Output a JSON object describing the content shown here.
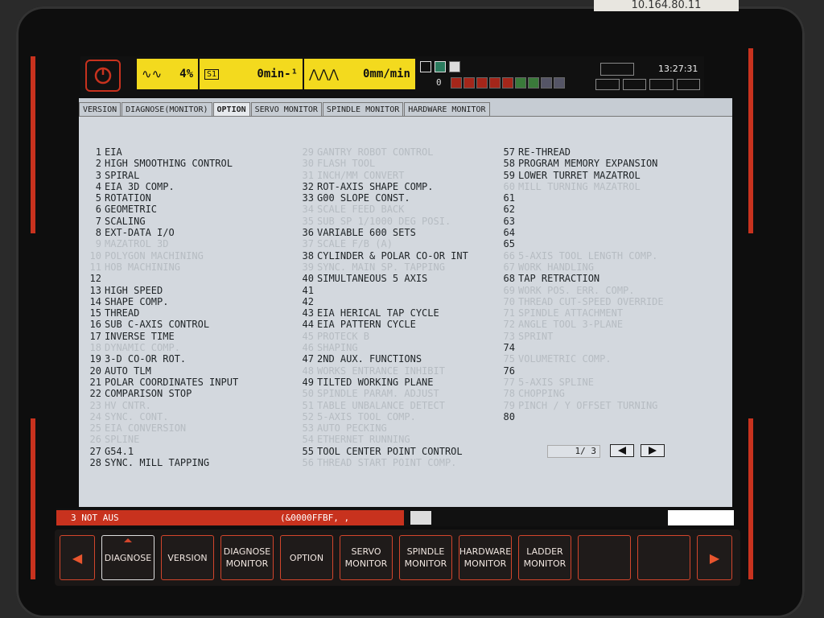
{
  "device": {
    "ip_tag": "10.164.80.11"
  },
  "header": {
    "spindle_override": "4%",
    "spindle_label": "S1",
    "spindle_speed": "0min-¹",
    "feed": "0mm/min",
    "counter": "0",
    "time": "13:27:31"
  },
  "tabs": [
    {
      "label": "VERSION"
    },
    {
      "label": "DIAGNOSE(MONITOR)"
    },
    {
      "label": "OPTION"
    },
    {
      "label": "SERVO MONITOR"
    },
    {
      "label": "SPINDLE MONITOR"
    },
    {
      "label": "HARDWARE MONITOR"
    }
  ],
  "options": {
    "col1": [
      {
        "num": "1",
        "label": "EIA",
        "active": true
      },
      {
        "num": "2",
        "label": "HIGH SMOOTHING CONTROL",
        "active": true
      },
      {
        "num": "3",
        "label": "SPIRAL",
        "active": true
      },
      {
        "num": "4",
        "label": "EIA 3D COMP.",
        "active": true
      },
      {
        "num": "5",
        "label": "ROTATION",
        "active": true
      },
      {
        "num": "6",
        "label": "GEOMETRIC",
        "active": true
      },
      {
        "num": "7",
        "label": "SCALING",
        "active": true
      },
      {
        "num": "8",
        "label": "EXT-DATA I/O",
        "active": true
      },
      {
        "num": "9",
        "label": "MAZATROL 3D",
        "active": false
      },
      {
        "num": "10",
        "label": "POLYGON MACHINING",
        "active": false
      },
      {
        "num": "11",
        "label": "HOB MACHINING",
        "active": false
      },
      {
        "num": "12",
        "label": "",
        "active": true
      },
      {
        "num": "13",
        "label": "HIGH SPEED",
        "active": true
      },
      {
        "num": "14",
        "label": "SHAPE COMP.",
        "active": true
      },
      {
        "num": "15",
        "label": "THREAD",
        "active": true
      },
      {
        "num": "16",
        "label": "SUB C-AXIS CONTROL",
        "active": true
      },
      {
        "num": "17",
        "label": "INVERSE TIME",
        "active": true
      },
      {
        "num": "18",
        "label": "DYNAMIC COMP.",
        "active": false
      },
      {
        "num": "19",
        "label": "3-D CO-OR ROT.",
        "active": true
      },
      {
        "num": "20",
        "label": "AUTO TLM",
        "active": true
      },
      {
        "num": "21",
        "label": "POLAR COORDINATES INPUT",
        "active": true
      },
      {
        "num": "22",
        "label": "COMPARISON STOP",
        "active": true
      },
      {
        "num": "23",
        "label": "HV CNTR.",
        "active": false
      },
      {
        "num": "24",
        "label": "SYNC. CONT.",
        "active": false
      },
      {
        "num": "25",
        "label": "EIA CONVERSION",
        "active": false
      },
      {
        "num": "26",
        "label": "SPLINE",
        "active": false
      },
      {
        "num": "27",
        "label": "G54.1",
        "active": true
      },
      {
        "num": "28",
        "label": "SYNC. MILL TAPPING",
        "active": true
      }
    ],
    "col2": [
      {
        "num": "29",
        "label": "GANTRY ROBOT CONTROL",
        "active": false
      },
      {
        "num": "30",
        "label": "FLASH TOOL",
        "active": false
      },
      {
        "num": "31",
        "label": "INCH/MM CONVERT",
        "active": false
      },
      {
        "num": "32",
        "label": "ROT-AXIS SHAPE COMP.",
        "active": true
      },
      {
        "num": "33",
        "label": "G00 SLOPE CONST.",
        "active": true
      },
      {
        "num": "34",
        "label": "SCALE FEED BACK",
        "active": false
      },
      {
        "num": "35",
        "label": "SUB SP 1/1000 DEG POSI.",
        "active": false
      },
      {
        "num": "36",
        "label": "VARIABLE 600 SETS",
        "active": true
      },
      {
        "num": "37",
        "label": "SCALE F/B (A)",
        "active": false
      },
      {
        "num": "38",
        "label": "CYLINDER & POLAR CO-OR INT",
        "active": true
      },
      {
        "num": "39",
        "label": "SYNC. MAIN SP. TAPPING",
        "active": false
      },
      {
        "num": "40",
        "label": "SIMULTANEOUS 5 AXIS",
        "active": true
      },
      {
        "num": "41",
        "label": "",
        "active": true
      },
      {
        "num": "42",
        "label": "",
        "active": true
      },
      {
        "num": "43",
        "label": "EIA HERICAL TAP CYCLE",
        "active": true
      },
      {
        "num": "44",
        "label": "EIA PATTERN CYCLE",
        "active": true
      },
      {
        "num": "45",
        "label": "PROTECK B",
        "active": false
      },
      {
        "num": "46",
        "label": "SHAPING",
        "active": false
      },
      {
        "num": "47",
        "label": "2ND AUX. FUNCTIONS",
        "active": true
      },
      {
        "num": "48",
        "label": "WORKS ENTRANCE INHIBIT",
        "active": false
      },
      {
        "num": "49",
        "label": "TILTED WORKING PLANE",
        "active": true
      },
      {
        "num": "50",
        "label": "SPINDLE PARAM. ADJUST",
        "active": false
      },
      {
        "num": "51",
        "label": "TABLE UNBALANCE DETECT",
        "active": false
      },
      {
        "num": "52",
        "label": "5-AXIS TOOL COMP.",
        "active": false
      },
      {
        "num": "53",
        "label": "AUTO PECKING",
        "active": false
      },
      {
        "num": "54",
        "label": "ETHERNET RUNNING",
        "active": false
      },
      {
        "num": "55",
        "label": "TOOL CENTER POINT CONTROL",
        "active": true
      },
      {
        "num": "56",
        "label": "THREAD START POINT COMP.",
        "active": false
      }
    ],
    "col3": [
      {
        "num": "57",
        "label": "RE-THREAD",
        "active": true
      },
      {
        "num": "58",
        "label": "PROGRAM MEMORY EXPANSION",
        "active": true
      },
      {
        "num": "59",
        "label": "LOWER TURRET MAZATROL",
        "active": true
      },
      {
        "num": "60",
        "label": "MILL TURNING MAZATROL",
        "active": false
      },
      {
        "num": "61",
        "label": "",
        "active": true
      },
      {
        "num": "62",
        "label": "",
        "active": true
      },
      {
        "num": "63",
        "label": "",
        "active": true
      },
      {
        "num": "64",
        "label": "",
        "active": true
      },
      {
        "num": "65",
        "label": "",
        "active": true
      },
      {
        "num": "66",
        "label": "5-AXIS TOOL LENGTH COMP.",
        "active": false
      },
      {
        "num": "67",
        "label": "WORK HANDLING",
        "active": false
      },
      {
        "num": "68",
        "label": "TAP RETRACTION",
        "active": true
      },
      {
        "num": "69",
        "label": "WORK POS. ERR. COMP.",
        "active": false
      },
      {
        "num": "70",
        "label": "THREAD CUT-SPEED OVERRIDE",
        "active": false
      },
      {
        "num": "71",
        "label": "SPINDLE ATTACHMENT",
        "active": false
      },
      {
        "num": "72",
        "label": "ANGLE TOOL 3-PLANE",
        "active": false
      },
      {
        "num": "73",
        "label": "SPRINT",
        "active": false
      },
      {
        "num": "74",
        "label": "",
        "active": true
      },
      {
        "num": "75",
        "label": "VOLUMETRIC COMP.",
        "active": false
      },
      {
        "num": "76",
        "label": "",
        "active": true
      },
      {
        "num": "77",
        "label": "5-AXIS SPLINE",
        "active": false
      },
      {
        "num": "78",
        "label": "CHOPPING",
        "active": false
      },
      {
        "num": "79",
        "label": "PINCH / Y OFFSET TURNING",
        "active": false
      },
      {
        "num": "80",
        "label": "",
        "active": true
      }
    ]
  },
  "pager": {
    "text": "1/ 3"
  },
  "status": {
    "alarm": "3 NOT AUS",
    "code": "(&0000FFBF,   ,"
  },
  "softkeys": [
    {
      "label": "DIAGNOSE",
      "selected": true
    },
    {
      "label": "VERSION"
    },
    {
      "label": "DIAGNOSE MONITOR"
    },
    {
      "label": "OPTION"
    },
    {
      "label": "SERVO MONITOR"
    },
    {
      "label": "SPINDLE MONITOR"
    },
    {
      "label": "HARDWARE MONITOR"
    },
    {
      "label": "LADDER MONITOR"
    },
    {
      "label": ""
    },
    {
      "label": ""
    }
  ],
  "colors": {
    "accent_red": "#c8321e",
    "status_yellow": "#f3da1e",
    "screen_bg": "#d3d8de",
    "inactive_text": "#b6bcc2"
  },
  "icons": {
    "eco": "power-eco-icon",
    "spindle_wave": "sine-wave-icon",
    "feed_wave": "zigzag-wave-icon",
    "prev": "triangle-left-icon",
    "next": "triangle-right-icon"
  }
}
